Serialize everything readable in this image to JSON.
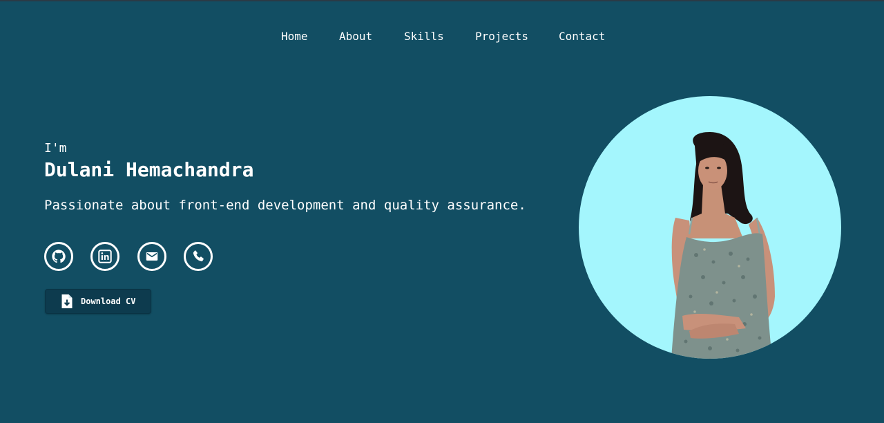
{
  "nav": {
    "items": [
      {
        "label": "Home"
      },
      {
        "label": "About"
      },
      {
        "label": "Skills"
      },
      {
        "label": "Projects"
      },
      {
        "label": "Contact"
      }
    ]
  },
  "hero": {
    "intro": "I'm",
    "name": "Dulani Hemachandra",
    "tagline": "Passionate about front-end development and quality assurance."
  },
  "socials": [
    {
      "icon": "github-icon"
    },
    {
      "icon": "linkedin-icon"
    },
    {
      "icon": "email-icon"
    },
    {
      "icon": "phone-icon"
    }
  ],
  "cv_button": {
    "label": "Download CV",
    "icon": "file-download-icon"
  },
  "profile_photo": {
    "icon": "profile-photo"
  },
  "colors": {
    "background": "#124e63",
    "photo_circle": "#a4f6fd",
    "button_bg": "#0d3b4e",
    "text": "#ffffff"
  }
}
